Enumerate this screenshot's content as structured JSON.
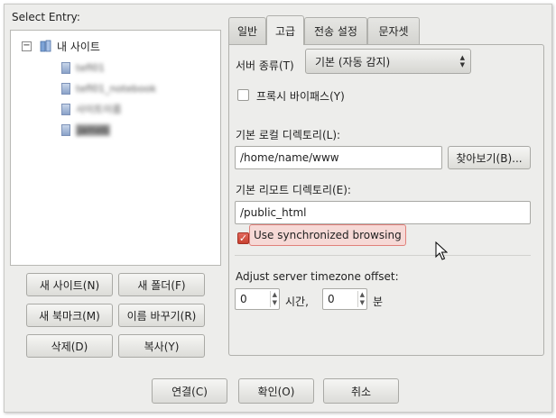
{
  "left": {
    "select_label": "Select Entry:",
    "tree": {
      "root_label": "내 사이트",
      "expander": "−",
      "children": [
        "tefl01",
        "tefl01_notebook",
        "사이트이름",
        "jameb"
      ]
    },
    "buttons": {
      "new_site": "새 사이트(N)",
      "new_folder": "새 폴더(F)",
      "new_bookmark": "새 북마크(M)",
      "rename": "이름 바꾸기(R)",
      "delete": "삭제(D)",
      "copy": "복사(Y)"
    }
  },
  "tabs": [
    "일반",
    "고급",
    "전송 설정",
    "문자셋"
  ],
  "advanced": {
    "server_type_label": "서버 종류(T)",
    "server_type_value": "기본 (자동 감지)",
    "bypass_proxy_label": "프록시 바이패스(Y)",
    "bypass_proxy_checked": false,
    "local_dir_label": "기본 로컬 디렉토리(L):",
    "local_dir_value": "/home/name/www",
    "browse_label": "찾아보기(B)...",
    "remote_dir_label": "기본 리모트 디렉토리(E):",
    "remote_dir_value": "/public_html",
    "sync_browsing_label": "Use synchronized browsing",
    "sync_browsing_checked": true,
    "checkmark": "✓",
    "timezone_label": "Adjust server timezone offset:",
    "hours_value": "0",
    "hours_unit": "시간,",
    "minutes_value": "0",
    "minutes_unit": "분"
  },
  "footer": {
    "connect": "연결(C)",
    "ok": "확인(O)",
    "cancel": "취소"
  },
  "colors": {
    "accent": "#d0493a",
    "dialog_bg": "#ededeb"
  }
}
